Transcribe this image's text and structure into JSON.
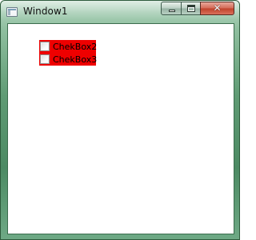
{
  "window": {
    "title": "Window1"
  },
  "caption_buttons": {
    "minimize_icon": "minimize-icon",
    "maximize_icon": "maximize-icon",
    "close_icon": "close-icon",
    "close_glyph": "✕"
  },
  "checkboxes": [
    {
      "label": "ChekBox2",
      "checked": false
    },
    {
      "label": "ChekBox3",
      "checked": false
    }
  ],
  "colors": {
    "checkbox_highlight": "#ee0000",
    "client_background": "#ffffff"
  }
}
